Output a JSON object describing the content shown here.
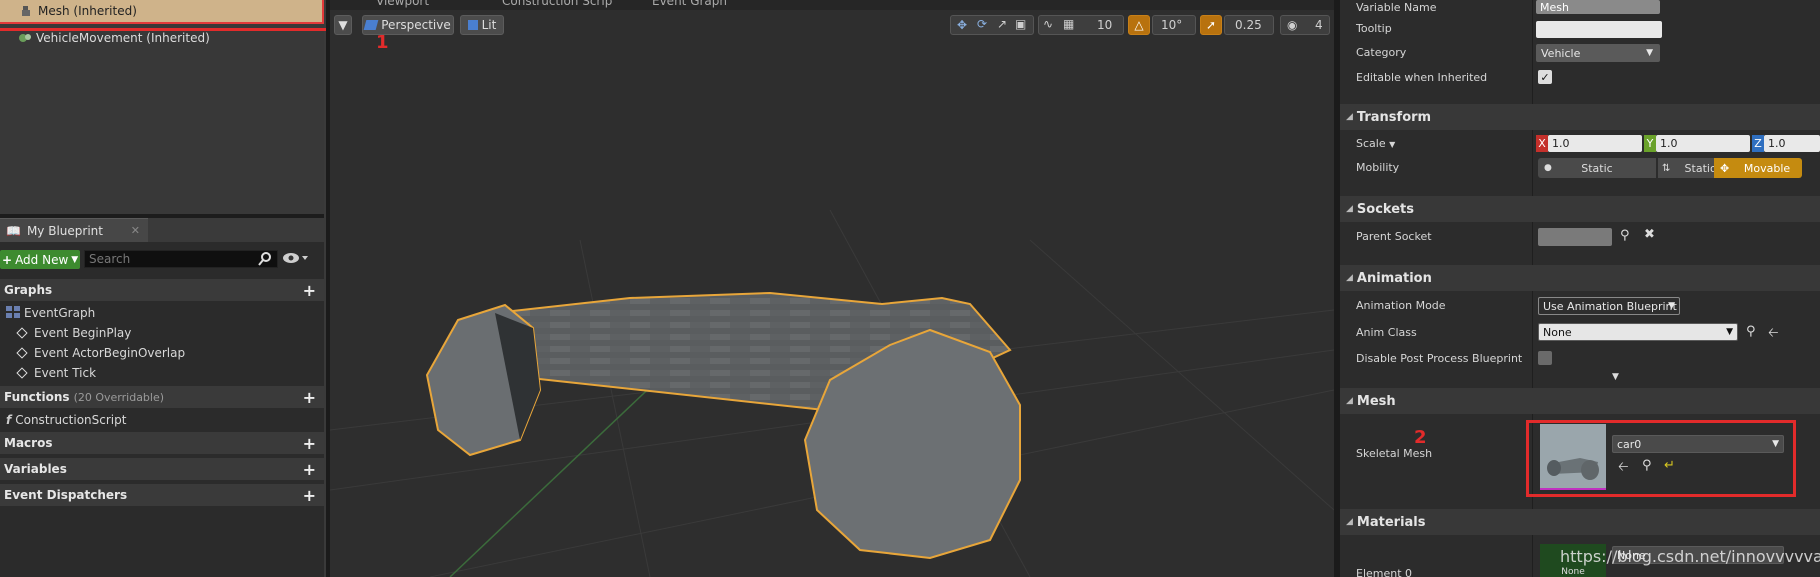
{
  "components": {
    "mesh": "Mesh (Inherited)",
    "vehicle_movement": "VehicleMovement (Inherited)"
  },
  "my_blueprint": {
    "tab_label": "My Blueprint",
    "add_new": "Add New",
    "search_placeholder": "Search",
    "graphs": "Graphs",
    "event_graph": "EventGraph",
    "events": [
      "Event BeginPlay",
      "Event ActorBeginOverlap",
      "Event Tick"
    ],
    "functions": "Functions",
    "functions_count": "(20 Overridable)",
    "construction_script": "ConstructionScript",
    "macros": "Macros",
    "variables": "Variables",
    "event_dispatchers": "Event Dispatchers"
  },
  "viewport": {
    "tabs": [
      "Viewport",
      "Construction Scrip",
      "Event Graph"
    ],
    "perspective": "Perspective",
    "lit": "Lit",
    "grid_snap": "10",
    "rotation_snap": "10°",
    "scale_snap": "0.25",
    "camera_speed": "4",
    "annotation_1": "1",
    "watermark": "https://blog.csdn.net/innovvvvvation"
  },
  "details": {
    "variable_name_label": "Variable Name",
    "variable_name_value": "Mesh",
    "tooltip_label": "Tooltip",
    "category_label": "Category",
    "category_value": "Vehicle",
    "editable_label": "Editable when Inherited",
    "transform_section": "Transform",
    "scale_label": "Scale",
    "scale_x": "1.0",
    "scale_y": "1.0",
    "scale_z": "1.0",
    "mobility_label": "Mobility",
    "mobility_static": "Static",
    "mobility_stationary": "Stationary",
    "mobility_movable": "Movable",
    "sockets_section": "Sockets",
    "parent_socket_label": "Parent Socket",
    "animation_section": "Animation",
    "anim_mode_label": "Animation Mode",
    "anim_mode_value": "Use Animation Blueprint",
    "anim_class_label": "Anim Class",
    "anim_class_value": "None",
    "disable_pp_label": "Disable Post Process Blueprint",
    "mesh_section": "Mesh",
    "skeletal_mesh_label": "Skeletal Mesh",
    "skeletal_mesh_value": "car0",
    "annotation_2": "2",
    "materials_section": "Materials",
    "element0_label": "Element 0",
    "element0_value": "None",
    "element0_thumb_label": "None"
  }
}
